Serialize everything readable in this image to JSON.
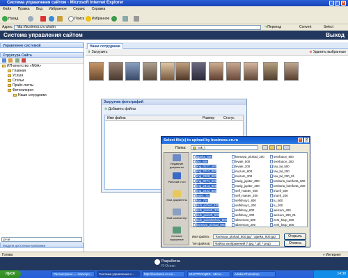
{
  "window": {
    "title": "Система управления сайтом - Microsoft Internet Explorer"
  },
  "menu": [
    "Файл",
    "Правка",
    "Вид",
    "Избранное",
    "Сервис",
    "Справка"
  ],
  "toolbar": {
    "back": "Назад",
    "search": "Поиск",
    "favorites": "Избранное"
  },
  "address": {
    "label": "Адрес:",
    "url": "http://business.cn.ru/adm",
    "go": "Переход",
    "connect": "Convert",
    "select": "Select"
  },
  "header": {
    "title": "Система управления сайтом",
    "exit": "Выход"
  },
  "left": {
    "panel_title": "Управление системой",
    "structure_title": "Структура Сайта",
    "tree": [
      "ИП-агентство «NGA»",
      "Главная",
      "Услуги",
      "Статьи",
      "Прайс-листы",
      "Фотогалерея",
      "Наши сотрудники"
    ],
    "search_value": "pr-ar",
    "modules_label": "Модули доступные компании"
  },
  "main": {
    "tab": "Наши сотрудники",
    "upload_btn": "Загрузить",
    "delete_btn": "Удалить выбранные"
  },
  "uploader": {
    "title": "Загрузчик фотографий",
    "add_btn": "Добавить файлы",
    "col_name": "Имя файла",
    "col_size": "Размер",
    "col_status": "Статус"
  },
  "dialog": {
    "title": "Select file(s) to upload by business.cn.ru",
    "folder_label": "Папка:",
    "folder_value": "nsk_l",
    "places": [
      "Недавние документы",
      "Рабочий стол",
      "Мои документы",
      "Мой компьютер",
      "Сетевое окружение"
    ],
    "files_col1": [
      "ajpeka_800",
      "dsc_800",
      "img_0127_400",
      "img_2012_800",
      "img_2208_800",
      "img_0271_620",
      "img_2413_800",
      "img_2443_800",
      "kalen_750",
      "kan_750",
      "klub_pohod_400",
      "klub_pulesh_300",
      "klub_pulesh_500",
      "klub_pulesherhov_800",
      "ksenaya_plohad_800"
    ],
    "files_col2": [
      "ksenaya_plohad_200",
      "levale_500",
      "levale_200",
      "muzum_800",
      "muzum_200",
      "navig_jupiter_800",
      "navig_jupiter_200",
      "self_master_500",
      "self_master_200",
      "selfshroy1_800",
      "selfshroy1_200",
      "selfshroy_800",
      "selfshroy_200",
      "sibremont_500",
      "sibremont_200"
    ],
    "files_col3": [
      "sverbutov_500",
      "sverbutov_200",
      "tau_lal_500",
      "tau_lal_200",
      "tau_lal_200_01",
      "territoria_komforta_500",
      "territoria_komforta_200",
      "triumf_500",
      "triumf_200",
      "tu_500",
      "tu_200",
      "welcom_400",
      "welcom_200_01",
      "zerk_harp_200",
      "zerk_harp_500"
    ],
    "filename_label": "Имя файла:",
    "filename_value": "\"ksenaya_plohad_800.jpg\" \"ajpeka_800.jpg\"",
    "filetype_label": "Тип файлов:",
    "filetype_value": "Файлы изображений (*.jpg, *.gif, *.png)",
    "open_btn": "Открыть",
    "cancel_btn": "Отмена"
  },
  "footer": {
    "dev_label": "Разработка",
    "dev_name": "R-Ocean"
  },
  "status": {
    "left": "Готово",
    "zone": "Интернет"
  },
  "taskbar": {
    "start": "пуск",
    "items": [
      "Рассмотрено — Электро...",
      "Система управления с...",
      "http://business.cn.ru/...",
      "ИНСТРУКЦИЯ - Micro...",
      "Adobe Photoshop"
    ],
    "clock": "14:38"
  },
  "colors": {
    "header_bg": "#23385e",
    "ie_title": "#2a5fd8",
    "selection": "#316ac5"
  }
}
